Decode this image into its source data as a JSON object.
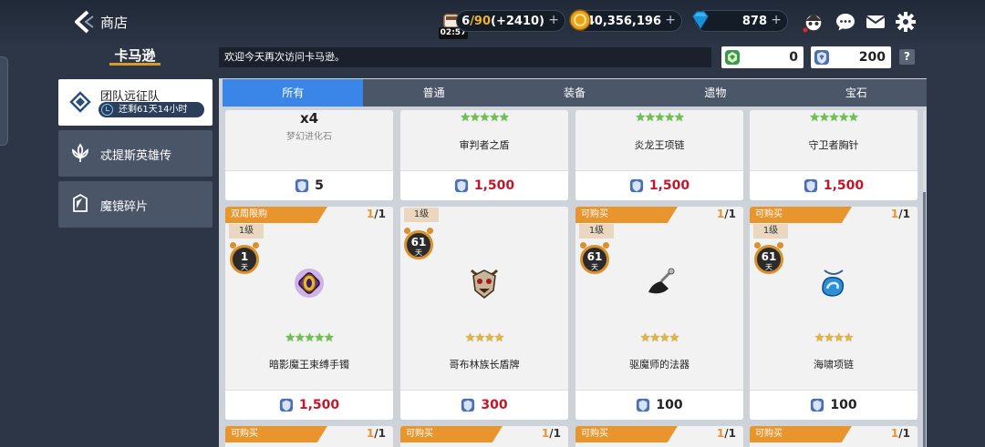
{
  "header": {
    "title": "商店",
    "timer": "02:57",
    "stamina": {
      "current": "6",
      "max": "/90",
      "bonus": "(+2410)"
    },
    "gold": "40,356,196",
    "gems": "878",
    "plus": "+"
  },
  "store_brand": "卡马逊",
  "welcome_text": "欢迎今天再次访问卡马逊。",
  "currencies": {
    "green_token": "0",
    "shield_token": "200"
  },
  "help_label": "?",
  "sidebar": {
    "items": [
      {
        "label": "团队远征队",
        "sub": "还剩61天14小时"
      },
      {
        "label": "忒提斯英雄传"
      },
      {
        "label": "魔镜碎片"
      }
    ]
  },
  "tabs": [
    "所有",
    "普通",
    "装备",
    "遗物",
    "宝石"
  ],
  "active_tab": "所有",
  "items_row1": [
    {
      "qty": "x4",
      "name": "梦幻进化石",
      "price": "5",
      "price_color": "dark"
    },
    {
      "name": "审判者之盾",
      "stars": "★★★★★",
      "price": "1,500",
      "price_color": "red"
    },
    {
      "name": "炎龙王项链",
      "stars": "★★★★★",
      "price": "1,500",
      "price_color": "red"
    },
    {
      "name": "守卫者胸针",
      "stars": "★★★★★",
      "price": "1,500",
      "price_color": "red"
    }
  ],
  "items_row2": [
    {
      "banner": "双周限购",
      "limit_cur": "1",
      "limit_max": "/1",
      "level": "1级",
      "days": "1",
      "days_unit": "天",
      "stars": "★★★★★",
      "name": "暗影魔王束缚手镯",
      "price": "1,500",
      "price_color": "red"
    },
    {
      "limit_cur": "",
      "limit_max": "",
      "level": "1级",
      "days": "61",
      "days_unit": "天",
      "stars": "★★★★",
      "name": "哥布林族长盾牌",
      "price": "300",
      "price_color": "red"
    },
    {
      "banner": "可购买",
      "limit_cur": "1",
      "limit_max": "/1",
      "level": "1级",
      "days": "61",
      "days_unit": "天",
      "stars": "★★★★",
      "name": "驱魔师的法器",
      "price": "100",
      "price_color": "dark"
    },
    {
      "banner": "可购买",
      "limit_cur": "1",
      "limit_max": "/1",
      "level": "1级",
      "days": "61",
      "days_unit": "天",
      "stars": "★★★★",
      "name": "海啸项链",
      "price": "100",
      "price_color": "dark"
    }
  ],
  "items_row3": [
    {
      "banner": "可购买",
      "limit_cur": "1",
      "limit_max": "/1"
    },
    {
      "banner": "可购买",
      "limit_cur": "1",
      "limit_max": "/1"
    },
    {
      "banner": "可购买",
      "limit_cur": "1",
      "limit_max": "/1"
    },
    {
      "banner": "可购买",
      "limit_cur": "1",
      "limit_max": "/1"
    }
  ],
  "colors": {
    "accent_tab": "#3a86e8",
    "banner": "#e8952e",
    "price_red": "#c4162a"
  }
}
